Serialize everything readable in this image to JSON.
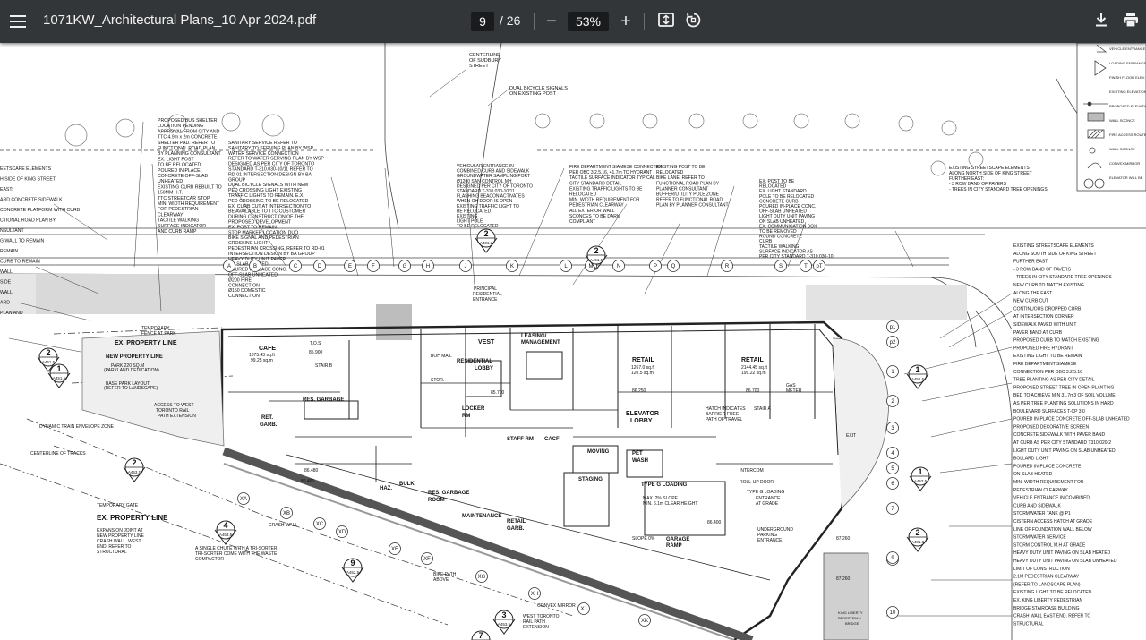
{
  "toolbar": {
    "title": "1071KW_Architectural Plans_10 Apr 2024.pdf",
    "page_current": "9",
    "page_total": "/ 26",
    "zoom": "53%",
    "zoom_out": "−",
    "zoom_in": "+",
    "download": "⭳",
    "print": "⎙"
  },
  "plan": {
    "top_notes": [
      "CENTERLINE",
      "OF SUDBURY",
      "STREET",
      "DUAL BICYCLE SIGNALS",
      "ON EXISTING POST"
    ],
    "legend": [
      "VEHICLE ENTRANCE",
      "LOADING ENTRANCE",
      "FINISH FLOOR ELEV.",
      "EXISTING ELEVATION",
      "PROPOSED ELEVATION",
      "WALL SCONCE",
      "FIRE ACCESS ROUTE",
      "WALL SCONCE",
      "CONVEX MIRROR",
      "ELEVATOR WILL BE"
    ],
    "left_notes": [
      "PROPOSED BUS SHELTER",
      "LOCATION PENDING",
      "APPROVAL FROM CITY AND",
      "TTC 4.9m x 2m CONCRETE",
      "SHELTER PAD. REFER TO",
      "FUNCTIONAL ROAD PLAN",
      "BY PLANNING CONSULTANT",
      "EX. LIGHT POST",
      "TO BE RELOCATED",
      "POURED IN-PLACE",
      "CONCRETE OFF-SLAB",
      "UNHEATED",
      "EXISTING CURB REBUILT TO",
      "150MM H.T.",
      "TTC STREETCAR STOP",
      "MIN. WIDTH REQUIREMENT",
      "FOR PEDESTRIAN",
      "CLEARWAY",
      "TACTILE WALKING",
      "SURFACE INDICATOR",
      "AND CURB RAMP"
    ],
    "far_left_notes": [
      "EETSCAPE ELEMENTS",
      "H SIDE OF KING STREET",
      "EAST:",
      "ARD CONCRETE SIDEWALK",
      "CONCRETE PLATFORM WITH CURB",
      "CTIONAL ROAD PLAN BY",
      "NSULTANT",
      "G WALL TO REMAIN",
      "REMAIN",
      "CURB TO REMAIN",
      "WALL",
      "SIDE",
      "WALL",
      "ARD",
      "PLAN AND"
    ],
    "mid_notes": [
      "SANITARY SERVICE REFER TO",
      "SANITARY TO SERVING PLAN BY WSP",
      "WATER SERVICE CONNECTION",
      "REFER TO WATER SERVING PLAN BY WSP",
      "DESIGNED AS PER CITY OF TORONTO",
      "STANDARD T-310.030-10/11 REFER TO",
      "RD-01 INTERSECTION DESIGN BY BA",
      "GROUP",
      "DUAL BICYCLE SIGNALS WITH NEW",
      "PED CROSSING LIGHT EXISTING",
      "TRAFFIC LIGHTS TO REMAIN. E.X.",
      "PED CROSSING TO BE RELOCATED",
      "EX. CURB CUT AT INTERSECTION TO",
      "BE AVAILABLE TO TTC CUSTOMER",
      "DURING CONSTRUCTION OF THE",
      "PROPOSED DEVELOPMENT",
      "EX. POST TO REMAIN",
      "STOP MARKER LOCATION DUO",
      "BIKE SIGNAL AND PEDESTRIAN",
      "CROSSING LIGHT",
      "PEDESTRIAN CROSSING, REFER TO RD-01",
      "INTERSECTION DESIGN BY BA GROUP",
      "HEAVY DUTY UNIT PAVER",
      "ON SLAB HEATED",
      "POURED IN-PLACE CONC.",
      "OFF-SLAB UNHEATED",
      "Ø200 FIRE",
      "CONNECTION",
      "Ø150 DOMESTIC",
      "CONNECTION"
    ],
    "center_notes": [
      "VEHICULAR ENTRANCE IN",
      "COMBINED CURB AND SIDEWALK",
      "GROUNDWATER SAMPLING PORT",
      "Ø1200 SAN CONTROL MH",
      "DESIGNED PER CITY OF TORONTO",
      "STANDARD T-310.030-10/11",
      "FLASHING BEACON ACTIVATES",
      "WHEN OH DOOR IS OPEN",
      "EXISTING TRAFFIC LIGHT TO",
      "BE RELOCATED",
      "EXISTING",
      "LIGHT POLE",
      "TO BE RELOCATED",
      "FIRE DEPARTMENT SIAMESE CONNECTION",
      "PER OBC 3.2.5.16, 41.7m TO HYDRANT",
      "TACTILE SURFACE INDICATOR TYPICAL",
      "CITY STANDARD DETAIL",
      "EXISTING TRAFFIC LIGHTS TO BE",
      "RELOCATED",
      "MIN. WIDTH REQUIREMENT FOR",
      "PEDESTRIAN CLEARWAY",
      "ALL EXTERIOR WALL",
      "SCONCES TO BE DARK",
      "COMPLIANT",
      "EXISTING POST TO BE",
      "RELOCATED",
      "BIKE LANE, REFER TO",
      "FUNCTIONAL ROAD PLAN BY",
      "PLANNER CONSULTANT",
      "BUFFER/UTILITY POLE ZONE",
      "REFER TO FUNCTIONAL ROAD",
      "PLAN BY PLANNER CONSULTANT"
    ],
    "right_notes_top": [
      "EX. POST TO BE",
      "RELOCATED",
      "EX. LIGHT STANDARD",
      "POLE TO BE RELOCATED",
      "CONCRETE CURB",
      "POURED IN-PLACE CONC.",
      "OFF-SLAB UNHEATED",
      "LIGHT DUTY UNIT PAVING",
      "ON SLAB UNHEATED",
      "EX. COMMUNICATION BOX",
      "TO BE REMOVED",
      "ROUND CONCRETE",
      "CURB",
      "TACTILE WALKING",
      "SURFACE INDICATOR AS",
      "PER CITY STANDARD T-310.030-10",
      "EXISTING STREETSCAPE ELEMENTS",
      "ALONG NORTH SIDE OF KING STREET",
      "FURTHER EAST:",
      "- 3 ROW BAND OF PAVERS",
      "- TREES IN CITY STANDARD TREE OPENINGS"
    ],
    "right_notes": [
      "EXISTING STREETSCAPE ELEMENTS",
      "ALONG SOUTH SIDE OF KING STREET",
      "FURTHER EAST:",
      "- 3 ROW BAND OF PAVERS",
      "- TREES IN CITY STANDARD TREE OPENINGS",
      "NEW CURB TO MATCH EXISTING",
      "ALONG THE EAST",
      "NEW CURB CUT",
      "CONTINUOUS DROPPED CURB",
      "AT INTERSECTION CORNER",
      "SIDEWALK PAVED WITH UNIT",
      "PAVER BAND AT CURB",
      "PROPOSED CURB TO MATCH EXISTING",
      "PROPOSED FIRE HYDRANT",
      "EXISTING LIGHT TO BE REMAIN",
      "FIRE DEPARTMENT SIAMESE",
      "CONNECTION PER OBC 3.2.5.16",
      "TREE PLANTING AS PER CITY DETAIL",
      "PROPOSED STREET TREE IN OPEN PLANTING",
      "BED TO ACHIEVE MIN 31.7m3 OF SOIL VOLUME",
      "AS PER TREE PLANTING SOLUTIONS IN HARD",
      "BOULEVARD SURFACES T-CP 3.0",
      "POURED IN-PLACE CONCRETE OFF-SLAB UNHEATED",
      "PROPOSED DECORATIVE SCREEN",
      "CONCRETE SIDEWALK WITH PAVER BAND",
      "AT CURB AS PER CITY STANDARD T310.020-2",
      "LIGHT DUTY UNIT PAVING ON SLAB UNHEATED",
      "BOLLARD LIGHT",
      "POURED IN-PLACE CONCRETE",
      "ON-SLAB HEATED",
      "MIN. WIDTH REQUIREMENT FOR",
      "PEDESTRIAN CLEARWAY",
      "VEHICLE ENTRANCE IN COMBINED",
      "CURB AND SIDEWALK",
      "STORMWATER TANK @ P1",
      "CISTERN ACCESS HATCH AT GRADE",
      "LINE OF FOUNDATION WALL BELOW",
      "STORMWATER SERVICE",
      "STORM CONTROL M.H AT GRADE",
      "HEAVY DUTY UNIT PAVING ON SLAB HEATED",
      "HEAVY DUTY UNIT PAVING ON SLAB UNHEATED",
      "LIMIT OF CONSTRUCTION",
      "2.1M PEDESTRIAN CLEARWAY",
      "(REFER TO LANDSCAPE PLAN)",
      "EXISTING LIGHT TO BE RELOCATED",
      "EX. KING LIBERTY PEDESTRIAN",
      "BRIDGE STAIRCASE BUILDING",
      "CRASH WALL EAST END. REFER TO",
      "STRUCTURAL"
    ],
    "lower_left_notes": [
      "TEMPORARY GATE",
      "EX. PROPERTY LINE",
      "EXPANSION JOINT AT",
      "NEW PROPERTY LINE",
      "CRASH WALL. WEST",
      "END. REFER TO",
      "STRUCTURAL",
      "A SINGLE CHUTE WITH A TRI-SORTER.",
      "TRI-SORTER COME WITH THE WASTE",
      "COMPACTOR",
      "DYNAMIC TRAIN ENVELOPE ZONE",
      "CENTERLINE OF TRACKS",
      "CRASH WALL",
      "BIKE PATH",
      "ABOVE",
      "WEST TORONTO",
      "RAIL PATH",
      "EXTENSION",
      "CONVEX MIRROR"
    ],
    "building_labels": [
      "EX. PROPERTY LINE",
      "NEW PROPERTY LINE",
      "PARK 220 SQ.M",
      "(PARKLAND DEDICATION)",
      "BASE PARK LAYOUT",
      "(REFER TO LANDSCAPE)",
      "TEMPORARY",
      "FENCE AT PARK",
      "ACCESS TO WEST",
      "TORONTO RAIL",
      "PATH EXTENSION",
      "CAFE",
      "1075.43 sq.ft",
      "99.25 sq.m",
      "T.O.S",
      "85.900",
      "STAIR B",
      "RES. GARBAGE",
      "RET.",
      "GARB.",
      "PRINCIPAL",
      "RESIDENTIAL",
      "ENTRANCE",
      "VEST",
      "RESIDENTIAL",
      "LOBBY",
      "BOH MAIL",
      "STOR.",
      "LEASING/",
      "MANAGEMENT",
      "RETAIL",
      "1267.0 sq.ft",
      "120.5 sq.m",
      "RETAIL",
      "2144.45 sq.ft",
      "199.22 sq.m",
      "GAS",
      "METER",
      "85.700",
      "86.250",
      "86.700",
      "LOCKER",
      "RM",
      "ELEVATOR",
      "LOBBY",
      "STAFF RM",
      "CACF",
      "MOVING",
      "PET",
      "WASH",
      "STAGING",
      "HAZ.",
      "BULK",
      "RES. GARBAGE",
      "ROOM",
      "MAINTENANCE",
      "RETAIL",
      "GARB.",
      "TYPE G LOADING",
      "SLOPE 0%",
      "GARAGE",
      "RAMP",
      "INTERCOM",
      "ROLL-UP DOOR",
      "TYPE G LOADING",
      "ENTRANCE",
      "AT GRADE",
      "UNDERGROUND",
      "PARKING",
      "ENTRANCE",
      "HATCH INDICATES",
      "BARRIER-FREE",
      "PATH OF TRAVEL",
      "STAIR A",
      "EXIT",
      "MAX. 2% SLOPE",
      "MIN. 6.1m CLEAR HEIGHT",
      "KING LIBERTY",
      "PEDESTRIAN",
      "BRIDGE",
      "87.260",
      "87.260",
      "86.400",
      "86.460",
      "86.480"
    ],
    "grid_labels": [
      "A",
      "B",
      "C",
      "D",
      "E",
      "F",
      "G",
      "H",
      "J",
      "K",
      "L",
      "M",
      "N",
      "P",
      "Q",
      "R",
      "S",
      "T",
      "pT",
      "XA",
      "XB",
      "XC",
      "XD",
      "XE",
      "XF",
      "XG",
      "XH",
      "XJ",
      "XK",
      "p1",
      "p2",
      "1",
      "2",
      "3",
      "4",
      "5",
      "6",
      "7",
      "8",
      "9",
      "10",
      "p10"
    ],
    "callouts": [
      {
        "num": "2",
        "ref": "A401.2"
      },
      {
        "num": "2",
        "ref": "A451.5"
      },
      {
        "num": "1",
        "ref": "A451.5"
      },
      {
        "num": "2",
        "ref": "A453.5"
      },
      {
        "num": "4",
        "ref": "A453.5"
      },
      {
        "num": "9",
        "ref": "A452.5"
      },
      {
        "num": "3",
        "ref": "A453.5"
      },
      {
        "num": "7",
        "ref": "A"
      },
      {
        "num": "1",
        "ref": "A451.5"
      },
      {
        "num": "1",
        "ref": "A453.5"
      },
      {
        "num": "2",
        "ref": "A401.0"
      },
      {
        "num": "2",
        "ref": "A451.5"
      }
    ]
  }
}
